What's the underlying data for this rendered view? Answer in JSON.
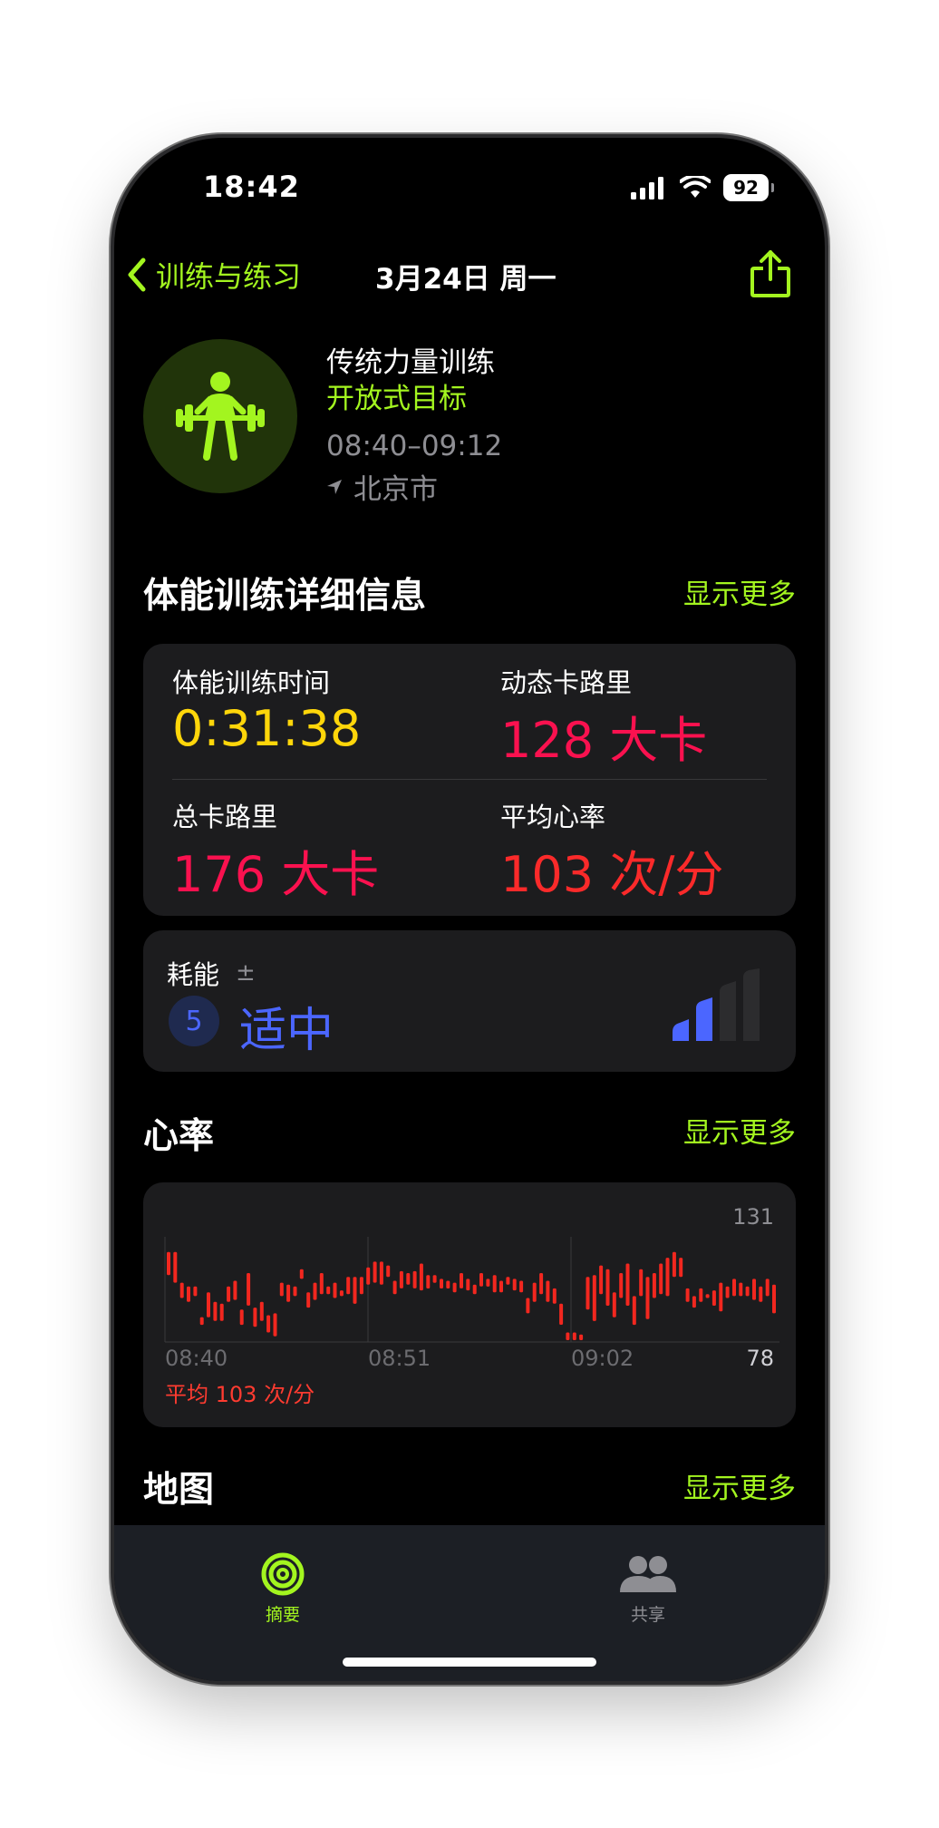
{
  "status": {
    "time": "18:42",
    "battery": "92"
  },
  "nav": {
    "back_label": "训练与练习",
    "title": "3月24日 周一"
  },
  "workout": {
    "name": "传统力量训练",
    "goal": "开放式目标",
    "time_range": "08:40–09:12",
    "location": "北京市"
  },
  "details": {
    "title": "体能训练详细信息",
    "more": "显示更多",
    "metrics": [
      {
        "label": "体能训练时间",
        "value": "0:31:38"
      },
      {
        "label": "动态卡路里",
        "value": "128 大卡"
      },
      {
        "label": "总卡路里",
        "value": "176 大卡"
      },
      {
        "label": "平均心率",
        "value": "103 次/分"
      }
    ]
  },
  "effort": {
    "label": "耗能",
    "pm": "±",
    "score": "5",
    "level": "适中",
    "bars_filled": 2,
    "bars_total": 4
  },
  "heart": {
    "title": "心率",
    "more": "显示更多",
    "max": "131",
    "min": "78",
    "ticks": [
      "08:40",
      "08:51",
      "09:02"
    ],
    "avg": "平均 103 次/分"
  },
  "chart_data": {
    "type": "bar",
    "ylim": [
      78,
      131
    ],
    "x": [
      "08:40",
      "08:51",
      "09:02"
    ],
    "series": [
      {
        "values": [
          [
            112,
            124
          ],
          [
            108,
            124
          ],
          [
            100,
            108
          ],
          [
            98,
            106
          ],
          [
            101,
            106
          ],
          [
            86,
            90
          ],
          [
            90,
            103
          ],
          [
            88,
            98
          ],
          [
            88,
            97
          ],
          [
            98,
            106
          ],
          [
            99,
            109
          ],
          [
            86,
            94
          ],
          [
            96,
            113
          ],
          [
            85,
            95
          ],
          [
            88,
            98
          ],
          [
            82,
            91
          ],
          [
            80,
            92
          ],
          [
            101,
            108
          ],
          [
            98,
            107
          ],
          [
            101,
            106
          ],
          [
            110,
            115
          ],
          [
            95,
            103
          ],
          [
            99,
            108
          ],
          [
            102,
            113
          ],
          [
            102,
            106
          ],
          [
            100,
            108
          ],
          [
            101,
            104
          ],
          [
            102,
            111
          ],
          [
            97,
            111
          ],
          [
            102,
            111
          ],
          [
            107,
            116
          ],
          [
            108,
            119
          ],
          [
            107,
            119
          ],
          [
            111,
            117
          ],
          [
            102,
            109
          ],
          [
            105,
            114
          ],
          [
            107,
            113
          ],
          [
            105,
            114
          ],
          [
            104,
            118
          ],
          [
            105,
            112
          ],
          [
            108,
            112
          ],
          [
            105,
            110
          ],
          [
            105,
            109
          ],
          [
            103,
            108
          ],
          [
            105,
            113
          ],
          [
            104,
            110
          ],
          [
            102,
            107
          ],
          [
            106,
            113
          ],
          [
            106,
            110
          ],
          [
            103,
            112
          ],
          [
            103,
            109
          ],
          [
            107,
            111
          ],
          [
            104,
            110
          ],
          [
            103,
            109
          ],
          [
            92,
            100
          ],
          [
            98,
            108
          ],
          [
            102,
            113
          ],
          [
            98,
            109
          ],
          [
            97,
            105
          ],
          [
            86,
            97
          ],
          [
            78,
            82
          ],
          [
            78,
            82
          ],
          [
            78,
            81
          ],
          [
            94,
            111
          ],
          [
            88,
            112
          ],
          [
            102,
            117
          ],
          [
            96,
            115
          ],
          [
            90,
            103
          ],
          [
            100,
            113
          ],
          [
            96,
            118
          ],
          [
            86,
            101
          ],
          [
            101,
            115
          ],
          [
            89,
            111
          ],
          [
            100,
            113
          ],
          [
            102,
            118
          ],
          [
            101,
            121
          ],
          [
            111,
            124
          ],
          [
            111,
            121
          ],
          [
            98,
            105
          ],
          [
            95,
            101
          ],
          [
            98,
            105
          ],
          [
            100,
            102
          ],
          [
            96,
            104
          ],
          [
            93,
            108
          ],
          [
            100,
            106
          ],
          [
            101,
            110
          ],
          [
            101,
            108
          ],
          [
            101,
            106
          ],
          [
            99,
            110
          ],
          [
            98,
            106
          ],
          [
            101,
            110
          ],
          [
            92,
            107
          ]
        ]
      }
    ]
  },
  "map": {
    "title": "地图",
    "more": "显示更多"
  },
  "tabs": [
    {
      "label": "摘要"
    },
    {
      "label": "共享"
    }
  ]
}
